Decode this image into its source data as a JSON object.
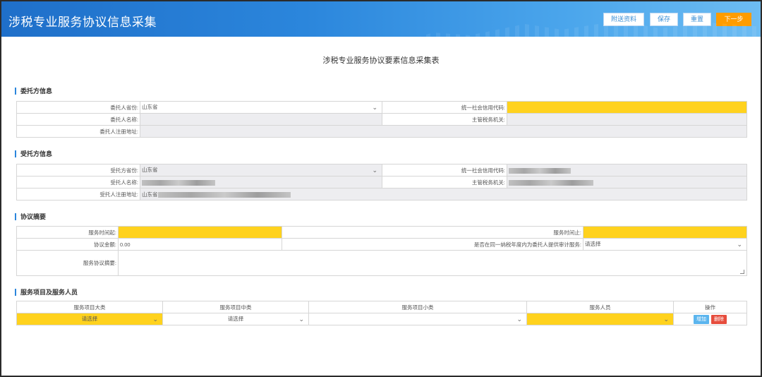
{
  "header": {
    "title": "涉税专业服务协议信息采集",
    "buttons": {
      "attach": "附送资料",
      "save": "保存",
      "reset": "重置",
      "next": "下一步"
    }
  },
  "form_title": "涉税专业服务协议要素信息采集表",
  "principal": {
    "section_title": "委托方信息",
    "province_label": "委托人省份:",
    "province_value": "山东省",
    "credit_code_label": "统一社会信用代码:",
    "name_label": "委托人名称:",
    "tax_authority_label": "主管税务机关:",
    "address_label": "委托人注册地址:"
  },
  "agent": {
    "section_title": "受托方信息",
    "province_label": "受托方省份:",
    "province_value": "山东省",
    "credit_code_label": "统一社会信用代码:",
    "name_label": "受托人名称:",
    "tax_authority_label": "主管税务机关:",
    "address_label": "受托人注册地址:",
    "address_prefix": "山东省"
  },
  "agreement": {
    "section_title": "协议摘要",
    "start_label": "服务时间起:",
    "end_label": "服务时间止:",
    "amount_label": "协议金额:",
    "amount_value": "0.00",
    "audit_label": "是否在同一纳税年度内为委托人提供审计服务:",
    "audit_value": "请选择",
    "summary_label": "服务协议摘要:"
  },
  "services": {
    "section_title": "服务项目及服务人员",
    "columns": [
      "服务项目大类",
      "服务项目中类",
      "服务项目小类",
      "服务人员",
      "操作"
    ],
    "row": {
      "major": "请选择",
      "middle": "请选择",
      "minor": "",
      "staff": ""
    },
    "add_label": "增加",
    "delete_label": "删除"
  },
  "colors": {
    "header": "#2b86dc",
    "required": "#ffd21e",
    "readonly": "#ededf0",
    "next_button": "#ff9c00",
    "delete_button": "#e64d3d",
    "add_button": "#5bb5ee"
  }
}
